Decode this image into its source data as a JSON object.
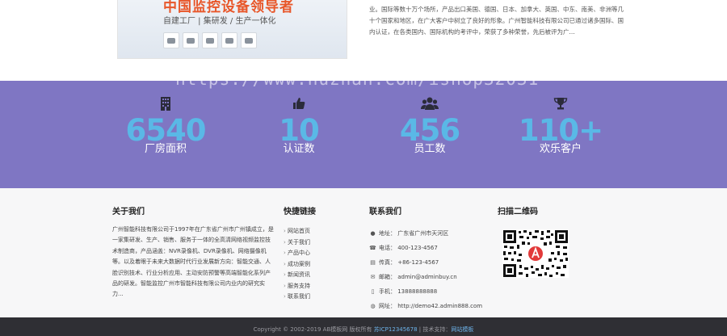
{
  "about": {
    "banner_title": "中国监控设备领导者",
    "banner_subtitle": "自建工厂 | 集研发 / 生产一体化",
    "text": "业。国际等数十万个场所，产品出口美国、德国、日本、加拿大、英国、中东、南美、非洲等几十个国家和地区，在广大客户中树立了良好的形象。广州智能科技有限公司已通过诸多国际、国内认证，在各类国内、国际机构的考评中，荣获了多种荣誉，先后被评为广..."
  },
  "watermark": "https://www.huzhan.com/ishop32031",
  "stats": [
    {
      "icon": "building-icon",
      "value": "6540",
      "label": "厂房面积"
    },
    {
      "icon": "thumbs-up-icon",
      "value": "10",
      "label": "认证数"
    },
    {
      "icon": "users-icon",
      "value": "456",
      "label": "员工数"
    },
    {
      "icon": "trophy-icon",
      "value": "110+",
      "label": "欢乐客户"
    }
  ],
  "footer": {
    "about_title": "关于我们",
    "about_text": "广州智能科技有限公司于1997年在广东省广州市广州镇成立，是一家集研发、生产、销售、服务于一体的全高清网络视频监控技术制造商，产品涵盖：NVR录像机、DVR录像机、网络摄像机等。以及着眼于未来大数据时代行业发展新方向：智能交通、人脸识别技术、行业分析应用、主动安防预警等高端智能化系列产品的研发。智能监控广州市智能科技有限公司内业内的研究实力...",
    "links_title": "快捷链接",
    "links": [
      "网站首页",
      "关于我们",
      "产品中心",
      "成功案例",
      "新闻资讯",
      "服务支持",
      "联系我们"
    ],
    "contact_title": "联系我们",
    "contact": [
      {
        "icon": "location-icon",
        "text": "地址：  广东省广州市天河区"
      },
      {
        "icon": "phone-icon",
        "text": "电话：  400-123-4567"
      },
      {
        "icon": "fax-icon",
        "text": "传真：  +86-123-4567"
      },
      {
        "icon": "email-icon",
        "text": "邮箱：  admin@adminbuy.cn"
      },
      {
        "icon": "mobile-icon",
        "text": "手机：  13888888888"
      },
      {
        "icon": "globe-icon",
        "text": "网址：  http://demo42.admin888.com"
      }
    ],
    "qr_title": "扫描二维码"
  },
  "bottom_bar": {
    "copyright": "Copyright © 2002-2019 AB模板网 版权所有",
    "icp": "苏ICP12345678",
    "tech": " | 技术支持：",
    "tech_link": "网站模板"
  },
  "colors": {
    "stats_bg": "#7f76c3",
    "stat_number": "#5ab8e6",
    "banner_title": "#e8572a",
    "bottom_bar_bg": "#2f2f34"
  }
}
